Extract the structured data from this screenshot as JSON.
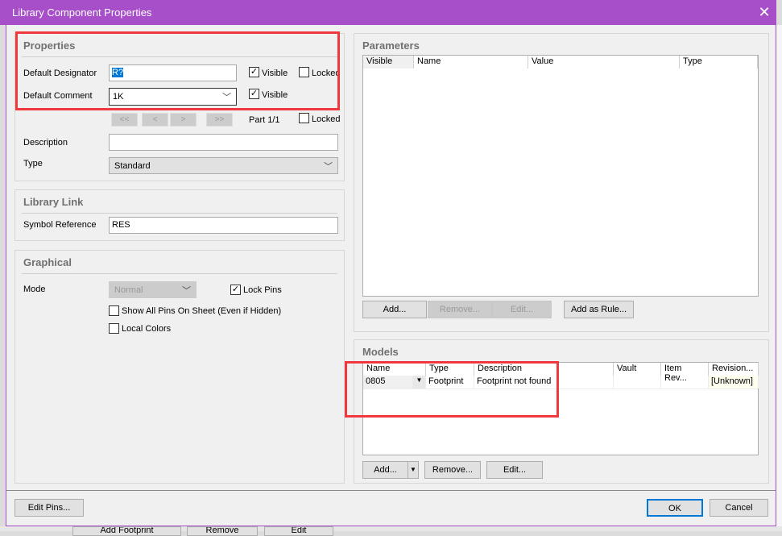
{
  "window": {
    "title": "Library Component Properties",
    "close_icon": "close-icon"
  },
  "properties": {
    "title": "Properties",
    "designator_label": "Default Designator",
    "designator_value": "R?",
    "designator_visible": true,
    "designator_locked": false,
    "comment_label": "Default Comment",
    "comment_value": "1K",
    "comment_visible": true,
    "visible_label": "Visible",
    "locked_label": "Locked",
    "nav": [
      "<<",
      "<",
      ">",
      ">>"
    ],
    "part": "Part 1/1",
    "part_locked": false,
    "description_label": "Description",
    "description_value": "",
    "type_label": "Type",
    "type_value": "Standard"
  },
  "library_link": {
    "title": "Library Link",
    "symbol_label": "Symbol Reference",
    "symbol_value": "RES"
  },
  "graphical": {
    "title": "Graphical",
    "mode_label": "Mode",
    "mode_value": "Normal",
    "lock_pins": "Lock Pins",
    "lock_pins_checked": true,
    "show_all_pins": "Show All Pins On Sheet (Even if Hidden)",
    "show_all_pins_checked": false,
    "local_colors": "Local Colors",
    "local_colors_checked": false
  },
  "parameters": {
    "title": "Parameters",
    "columns": [
      "Visible",
      "Name",
      "Value",
      "Type"
    ],
    "buttons": {
      "add": "Add...",
      "remove": "Remove...",
      "edit": "Edit...",
      "add_rule": "Add as Rule..."
    }
  },
  "models": {
    "title": "Models",
    "columns": [
      "Name",
      "Type",
      "Description",
      "Vault",
      "Item Rev...",
      "Revision..."
    ],
    "rows": [
      {
        "name": "0805",
        "type": "Footprint",
        "description": "Footprint not found",
        "vault": "",
        "item_rev": "",
        "revision": "[Unknown]"
      }
    ],
    "buttons": {
      "add": "Add...",
      "remove": "Remove...",
      "edit": "Edit..."
    }
  },
  "footer": {
    "edit_pins": "Edit Pins...",
    "ok": "OK",
    "cancel": "Cancel"
  },
  "background": {
    "add_footprint": "Add Footprint",
    "remove": "Remove",
    "edit": "Edit"
  },
  "colors": {
    "title_bar": "#a64fc8",
    "highlight": "#f0383e",
    "ok_border": "#0078d7"
  }
}
